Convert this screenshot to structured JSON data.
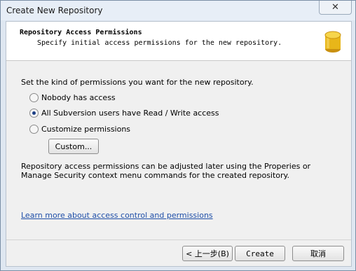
{
  "window": {
    "title": "Create New Repository",
    "close_glyph": "✕"
  },
  "header": {
    "title": "Repository Access Permissions",
    "subtitle": "Specify initial access permissions for the new repository.",
    "icon": "database-icon"
  },
  "main": {
    "prompt": "Set the kind of permissions you want for the new repository.",
    "options": [
      {
        "label": "Nobody has access",
        "checked": false
      },
      {
        "label": "All Subversion users have Read / Write access",
        "checked": true
      },
      {
        "label": "Customize permissions",
        "checked": false
      }
    ],
    "custom_button": "Custom...",
    "note": "Repository access permissions can be adjusted later using the Properies or Manage Security context menu commands for the created repository.",
    "link": "Learn more about access control and permissions"
  },
  "footer": {
    "back": "< 上一步(B)",
    "create": "Create",
    "cancel": "取消"
  },
  "colors": {
    "accent": "#1f4fa8",
    "icon_yellow": "#e8b619"
  }
}
